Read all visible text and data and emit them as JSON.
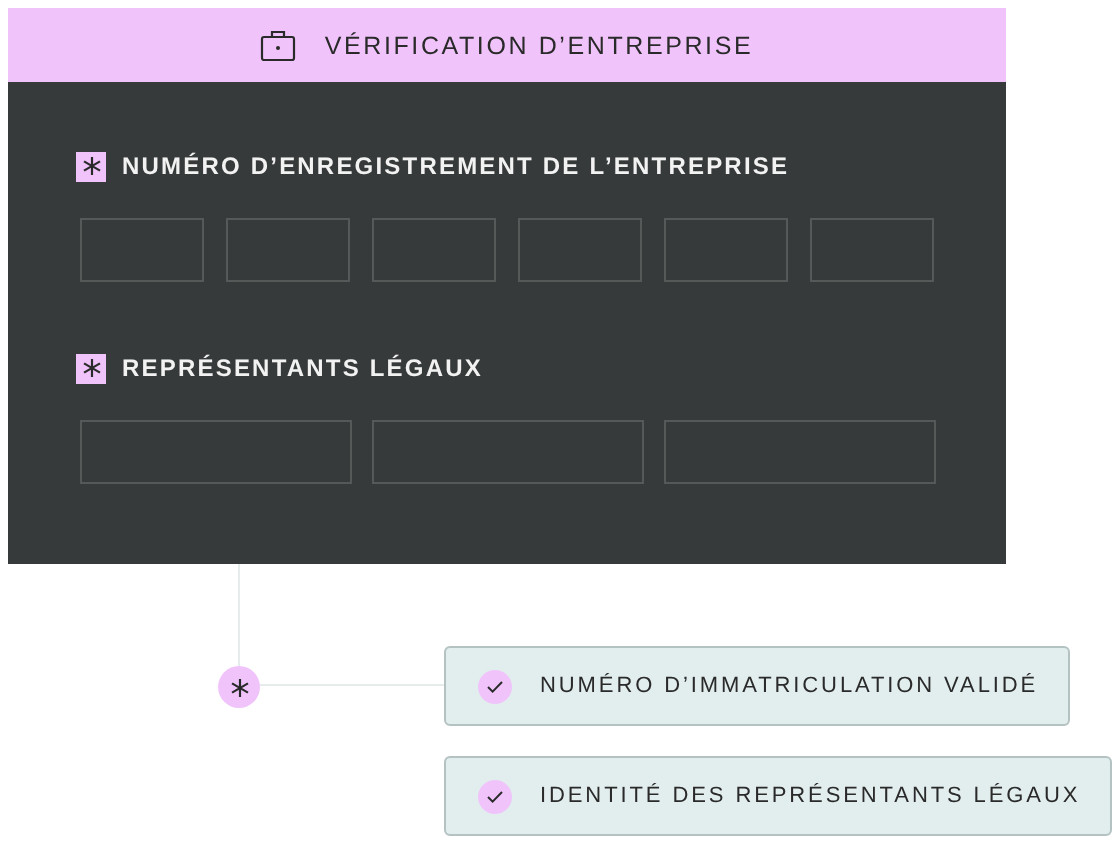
{
  "card": {
    "title": "VÉRIFICATION D’ENTREPRISE",
    "sections": [
      {
        "label": "NUMÉRO D’ENREGISTREMENT DE L’ENTREPRISE",
        "required": true,
        "inputs": [
          {
            "kind": "short"
          },
          {
            "kind": "short"
          },
          {
            "kind": "short"
          },
          {
            "kind": "short"
          },
          {
            "kind": "short"
          },
          {
            "kind": "short"
          }
        ]
      },
      {
        "label": "REPRÉSENTANTS LÉGAUX",
        "required": true,
        "inputs": [
          {
            "kind": "wide"
          },
          {
            "kind": "wide"
          },
          {
            "kind": "wide"
          }
        ]
      }
    ]
  },
  "results": [
    {
      "label": "NUMÉRO D’IMMATRICULATION VALIDÉ",
      "checked": true
    },
    {
      "label": "IDENTITÉ DES REPRÉSENTANTS LÉGAUX",
      "checked": true
    }
  ]
}
